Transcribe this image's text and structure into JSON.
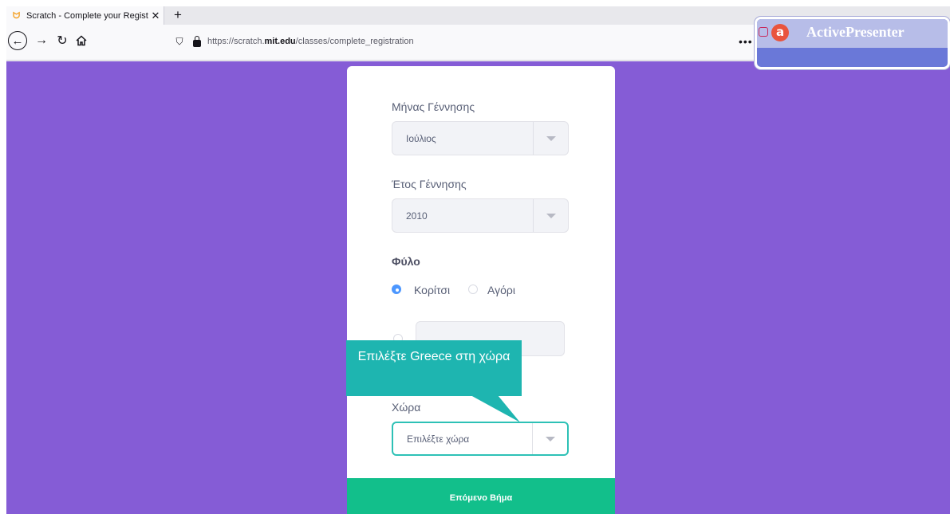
{
  "browser": {
    "tab_title": "Scratch - Complete your Regist",
    "tab_close": "✕",
    "new_tab": "+",
    "url_host_prefix": "https://scratch.",
    "url_host": "mit.edu",
    "url_path": "/classes/complete_registration",
    "menu_dots": "•••"
  },
  "overlay": {
    "brand": "ActivePresenter",
    "logo_letter": "a"
  },
  "form": {
    "birth_month_label": "Μήνας Γέννησης",
    "birth_month_value": "Ιούλιος",
    "birth_year_label": "Έτος Γέννησης",
    "birth_year_value": "2010",
    "gender_title": "Φύλο",
    "gender_options": [
      "Κορίτσι",
      "Αγόρι"
    ],
    "country_label": "Χώρα",
    "country_placeholder": "Επιλέξτε χώρα",
    "next_button": "Επόμενο Βήμα"
  },
  "callout": {
    "text": "Επιλέξτε Greece στη χώρα"
  },
  "colors": {
    "page_bg": "#855cd6",
    "next_button": "#12bf8b",
    "callout": "#1eb5b0",
    "active_border": "#2ec1b6"
  }
}
